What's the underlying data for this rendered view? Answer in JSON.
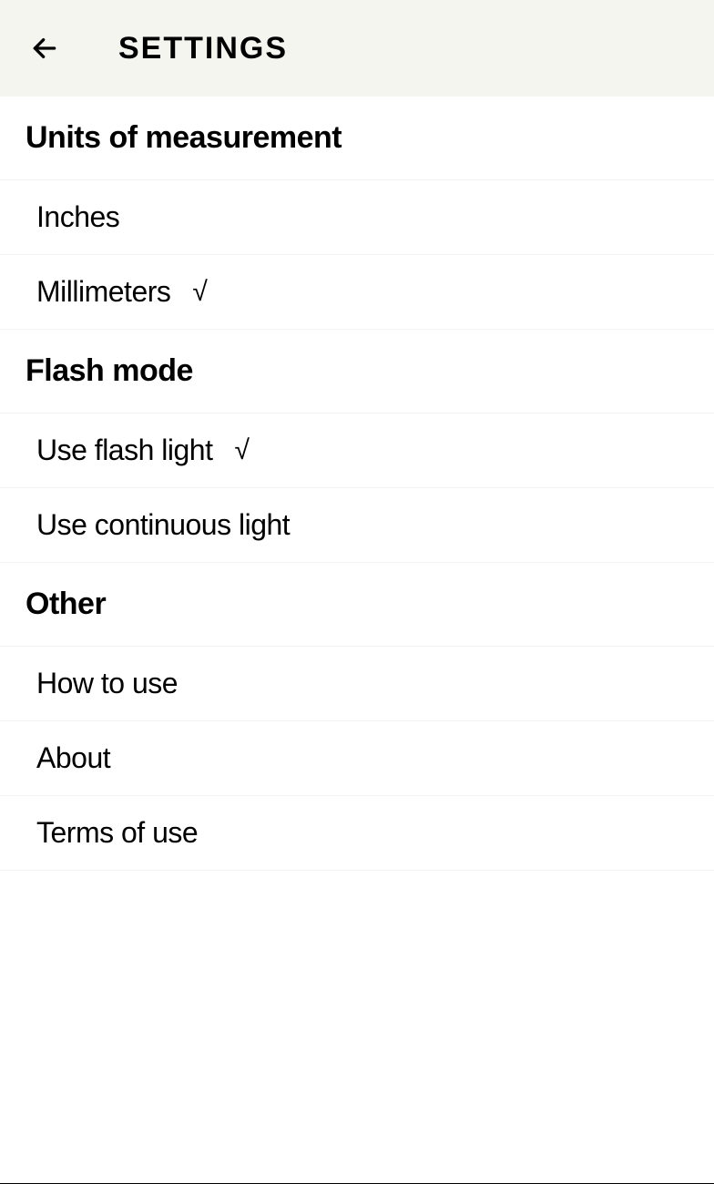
{
  "header": {
    "title": "SETTINGS"
  },
  "sections": {
    "units": {
      "title": "Units of measurement",
      "options": {
        "inches": "Inches",
        "millimeters": "Millimeters"
      }
    },
    "flash": {
      "title": "Flash mode",
      "options": {
        "flash_light": "Use flash light",
        "continuous_light": "Use continuous light"
      }
    },
    "other": {
      "title": "Other",
      "options": {
        "how_to_use": "How to use",
        "about": "About",
        "terms": "Terms of use"
      }
    }
  },
  "checkmark": "√"
}
